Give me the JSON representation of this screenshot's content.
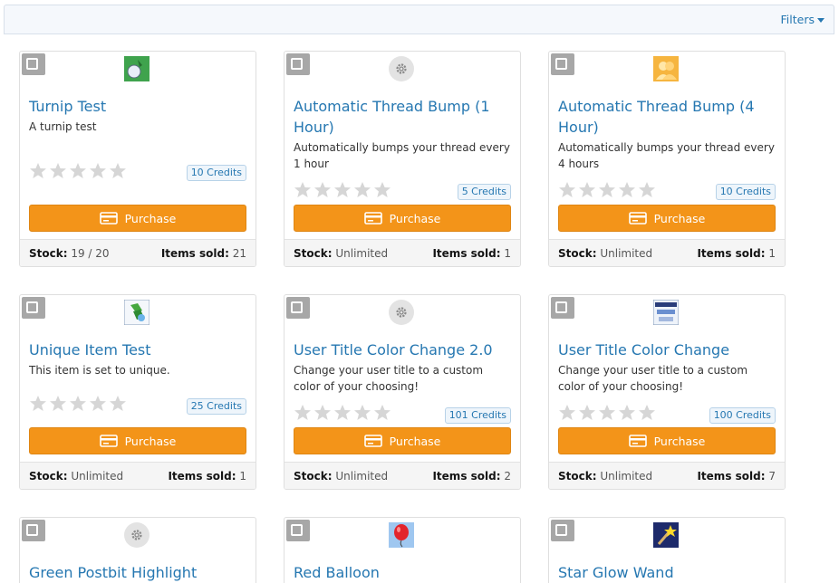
{
  "filter_bar": {
    "filters_label": "Filters"
  },
  "labels": {
    "purchase": "Purchase",
    "stock_label": "Stock:",
    "sold_label": "Items sold:"
  },
  "colors": {
    "accent": "#2577b1",
    "purchase": "#f39419",
    "star": "#d6d6d6"
  },
  "items": [
    {
      "title": "Turnip Test",
      "description": "A turnip test",
      "credits": "10 Credits",
      "stock": "19 / 20",
      "sold": "21",
      "icon": "turnip-item-icon",
      "rating": 0
    },
    {
      "title": "Automatic Thread Bump (1 Hour)",
      "description": "Automatically bumps your thread every 1 hour",
      "credits": "5 Credits",
      "stock": "Unlimited",
      "sold": "1",
      "icon": "gear-icon",
      "rating": 0
    },
    {
      "title": "Automatic Thread Bump (4 Hour)",
      "description": "Automatically bumps your thread every 4 hours",
      "credits": "10 Credits",
      "stock": "Unlimited",
      "sold": "1",
      "icon": "users-item-icon",
      "rating": 0
    },
    {
      "title": "Unique Item Test",
      "description": "This item is set to unique.",
      "credits": "25 Credits",
      "stock": "Unlimited",
      "sold": "1",
      "icon": "unique-item-icon",
      "rating": 0
    },
    {
      "title": "User Title Color Change 2.0",
      "description": "Change your user title to a custom color of your choosing!",
      "credits": "101 Credits",
      "stock": "Unlimited",
      "sold": "2",
      "icon": "gear-icon",
      "rating": 0
    },
    {
      "title": "User Title Color Change",
      "description": "Change your user title to a custom color of your choosing!",
      "credits": "100 Credits",
      "stock": "Unlimited",
      "sold": "7",
      "icon": "user-title-item-icon",
      "rating": 0
    },
    {
      "title": "Green Postbit Highlight",
      "icon": "gear-icon"
    },
    {
      "title": "Red Balloon",
      "icon": "balloon-item-icon"
    },
    {
      "title": "Star Glow Wand",
      "icon": "wand-item-icon"
    }
  ]
}
